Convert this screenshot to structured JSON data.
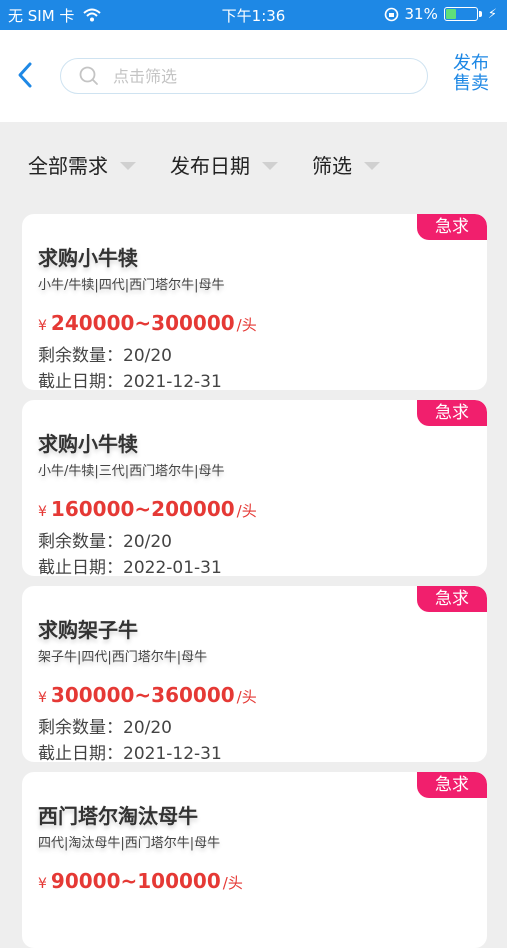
{
  "status_bar": {
    "carrier": "无 SIM 卡",
    "time": "下午1:36",
    "battery": "31%"
  },
  "header": {
    "search_placeholder": "点击筛选",
    "publish_line1": "发布",
    "publish_line2": "售卖"
  },
  "filters": [
    {
      "label": "全部需求"
    },
    {
      "label": "发布日期"
    },
    {
      "label": "筛选"
    }
  ],
  "listings": [
    {
      "badge": "急求",
      "title": "求购小牛犊",
      "tags": "小牛/牛犊|四代|西门塔尔牛|母牛",
      "currency": "¥",
      "price": "240000~300000",
      "unit": "/头",
      "qty_label": "剩余数量：",
      "qty": "20/20",
      "deadline_label": "截止日期：",
      "deadline": "2021-12-31"
    },
    {
      "badge": "急求",
      "title": "求购小牛犊",
      "tags": "小牛/牛犊|三代|西门塔尔牛|母牛",
      "currency": "¥",
      "price": "160000~200000",
      "unit": "/头",
      "qty_label": "剩余数量：",
      "qty": "20/20",
      "deadline_label": "截止日期：",
      "deadline": "2022-01-31"
    },
    {
      "badge": "急求",
      "title": "求购架子牛",
      "tags": "架子牛|四代|西门塔尔牛|母牛",
      "currency": "¥",
      "price": "300000~360000",
      "unit": "/头",
      "qty_label": "剩余数量：",
      "qty": "20/20",
      "deadline_label": "截止日期：",
      "deadline": "2021-12-31"
    },
    {
      "badge": "急求",
      "title": "西门塔尔淘汰母牛",
      "tags": "四代|淘汰母牛|西门塔尔牛|母牛",
      "currency": "¥",
      "price": "90000~100000",
      "unit": "/头"
    }
  ],
  "colors": {
    "primary": "#1e88e5",
    "badge": "#f11f6d",
    "price": "#e53935"
  }
}
